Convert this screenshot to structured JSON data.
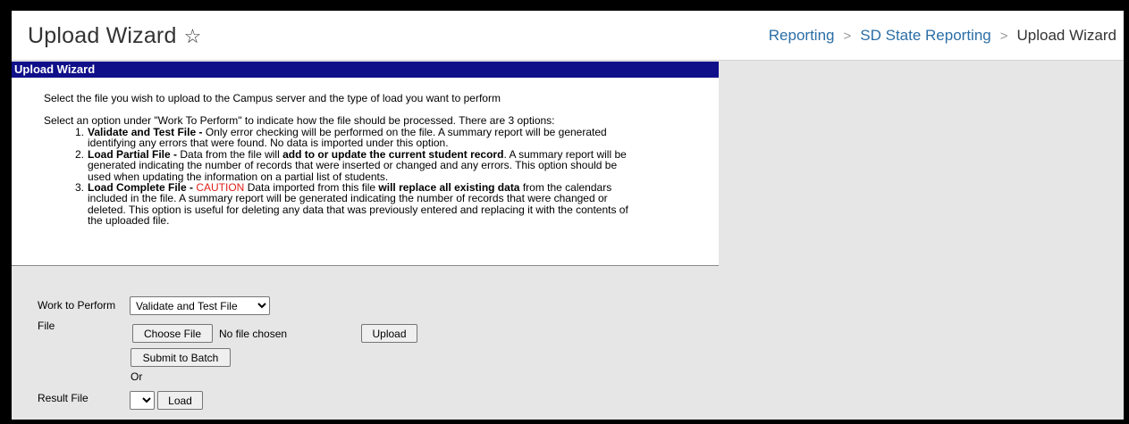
{
  "header": {
    "title": "Upload Wizard",
    "star_icon": "star-outline-icon",
    "breadcrumb": {
      "item1": "Reporting",
      "item2": "SD State Reporting",
      "current": "Upload Wizard",
      "separator": ">"
    }
  },
  "panel": {
    "title": "Upload Wizard",
    "intro": "Select the file you wish to upload to the Campus server and the type of load you want to perform",
    "options_intro": "Select an option under \"Work To Perform\" to indicate how the file should be processed. There are 3 options:",
    "options": [
      {
        "num": "1.",
        "bold": "Validate and Test File -",
        "line1": " Only error checking will be performed on the file. A summary report will be generated",
        "line2": "identifying any errors that were found. No data is imported under this option."
      },
      {
        "num": "2.",
        "bold": "Load Partial File -",
        "mid": " Data from the file will ",
        "bold2": "add to or update the current student record",
        "line1_end": ". A summary report will be",
        "line2": "generated indicating the number of records that were inserted or changed and any errors. This option should be",
        "line3": "used when updating the information on a partial list of students."
      },
      {
        "num": "3.",
        "bold": "Load Complete File -",
        "caution": " CAUTION",
        "mid": " Data imported from this file ",
        "bold2": "will replace all existing data",
        "line1_end": " from the calendars",
        "line2": "included in the file. A summary report will be generated indicating the number of records that were changed or",
        "line3": "deleted. This option is useful for deleting any data that was previously entered and replacing it with the contents of",
        "line4": "the uploaded file."
      }
    ],
    "colors": {
      "bar": "#0f0f8a",
      "caution": "#e0211b",
      "link": "#2b6ea6"
    }
  },
  "form": {
    "work_label": "Work to Perform",
    "work_value": "Validate and Test File",
    "file_label": "File",
    "choose_file": "Choose File",
    "no_file": "No file chosen",
    "upload": "Upload",
    "submit_batch": "Submit to Batch",
    "or": "Or",
    "result_label": "Result File",
    "result_value": "",
    "load": "Load"
  }
}
